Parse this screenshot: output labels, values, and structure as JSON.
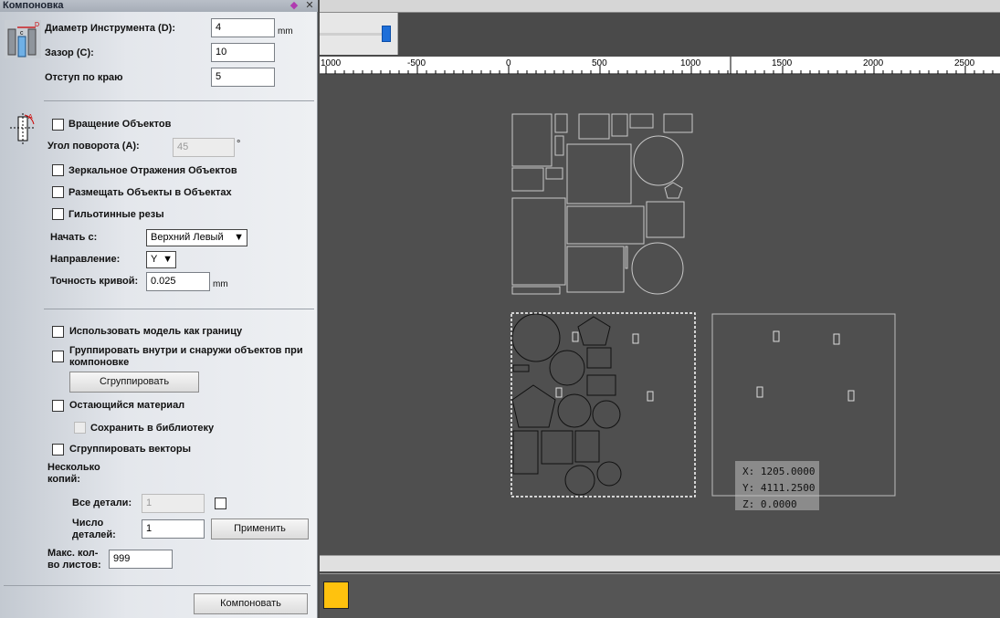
{
  "panel": {
    "title": "Компоновка",
    "tool_diameter_label": "Диаметр Инструмента (D):",
    "tool_diameter_value": "4",
    "tool_diameter_unit": "mm",
    "gap_label": "Зазор (C):",
    "gap_value": "10",
    "edge_offset_label": "Отступ по краю",
    "edge_offset_value": "5",
    "rotate_objects_label": "Вращение Объектов",
    "rotation_angle_label": "Угол поворота (A):",
    "rotation_angle_value": "45",
    "rotation_angle_unit": "°",
    "mirror_label": "Зеркальное Отражения Объектов",
    "nest_in_objects_label": "Размещать Объекты в Объектах",
    "guillotine_label": "Гильотинные резы",
    "start_from_label": "Начать с:",
    "start_from_value": "Верхний Левый",
    "direction_label": "Направление:",
    "direction_value": "Y",
    "curve_precision_label": "Точность кривой:",
    "curve_precision_value": "0.025",
    "curve_precision_unit": "mm",
    "use_model_boundary_label": "Использовать модель как границу",
    "group_inside_outside_label": "Группировать внутри и снаружи объектов при компоновке",
    "group_button": "Сгруппировать",
    "remaining_material_label": "Остающийся материал",
    "save_to_library_label": "Сохранить в библиотеку",
    "group_vectors_label": "Сгруппировать векторы",
    "multiple_copies_label": "Несколько копий:",
    "all_parts_label": "Все детали:",
    "all_parts_value": "1",
    "parts_count_label": "Число деталей:",
    "parts_count_value": "1",
    "apply_button": "Применить",
    "max_sheets_label": "Макс. кол-во листов:",
    "max_sheets_value": "999",
    "nest_button": "Компоновать"
  },
  "ruler": {
    "ticks": [
      "1000",
      "-500",
      "0",
      "500",
      "1000",
      "1500",
      "2000",
      "2500"
    ]
  },
  "coords": {
    "x": "X: 1205.0000",
    "y": "Y: 4111.2500",
    "z": "Z: 0.0000"
  },
  "colors": {
    "swatch": "#ffc20e",
    "slider_thumb": "#1e6fd9"
  }
}
